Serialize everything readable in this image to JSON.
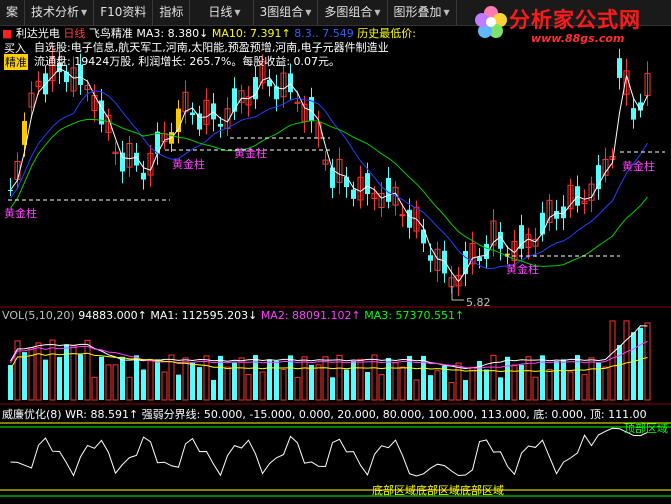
{
  "toolbar": {
    "items": [
      {
        "label": "案"
      },
      {
        "label": "技术分析",
        "dropdown": true
      },
      {
        "label": "F10资料"
      },
      {
        "label": "指标"
      },
      {
        "label": "日线",
        "dropdown": true
      },
      {
        "label": "3图组合",
        "dropdown": true
      },
      {
        "label": "多图组合",
        "dropdown": true
      },
      {
        "label": "图形叠加",
        "dropdown": true
      }
    ]
  },
  "logo": {
    "text": "分析家公式网",
    "url": "www.88gs.com"
  },
  "main": {
    "stock_name": "利达光电",
    "period": "日线",
    "indicator": "飞鸟精准",
    "ma3": "MA3: 8.380↓",
    "ma10": "MA10: 7.391↑",
    "ma_other": "8.3..  7.549",
    "history_low": "历史最低价:",
    "side_label_1": "买入",
    "side_label_2": "精准"
  },
  "info_panel": {
    "line1": "自选股:电子信息,航天军工,河南,太阳能,预盈预增,河南,电子元器件制造业",
    "line2": "流通盘: 19424万股, 利润增长: 265.7%。每股收益: 0.07元。"
  },
  "annotations": {
    "golden_column": "黄金柱",
    "low_price": "5.82"
  },
  "volume": {
    "header": "VOL(5,10,20)",
    "vol": "94883.000↑",
    "ma1": "MA1: 112595.203↓",
    "ma2": "MA2: 88091.102↑",
    "ma3": "MA3: 57370.551↑"
  },
  "indicator": {
    "name": "威廉优化(8)",
    "wr": "WR: 88.591↑",
    "params": "强弱分界线: 50.000, -15.000, 0.000, 20.000, 80.000, 100.000, 113.000, 底: 0.000, 顶: 111.00",
    "bottom_zone": "底部区域底部区域底部区域",
    "top_zone": "顶部区域"
  },
  "colors": {
    "up": "#ff3232",
    "down": "#54ffff",
    "ma_white": "#ffffff",
    "ma_yellow": "#ffff00",
    "ma_blue": "#2040ff",
    "ma_green": "#00cc00",
    "gold": "#ffc800",
    "magenta": "#ff40ff",
    "separator": "#8b0000"
  }
}
